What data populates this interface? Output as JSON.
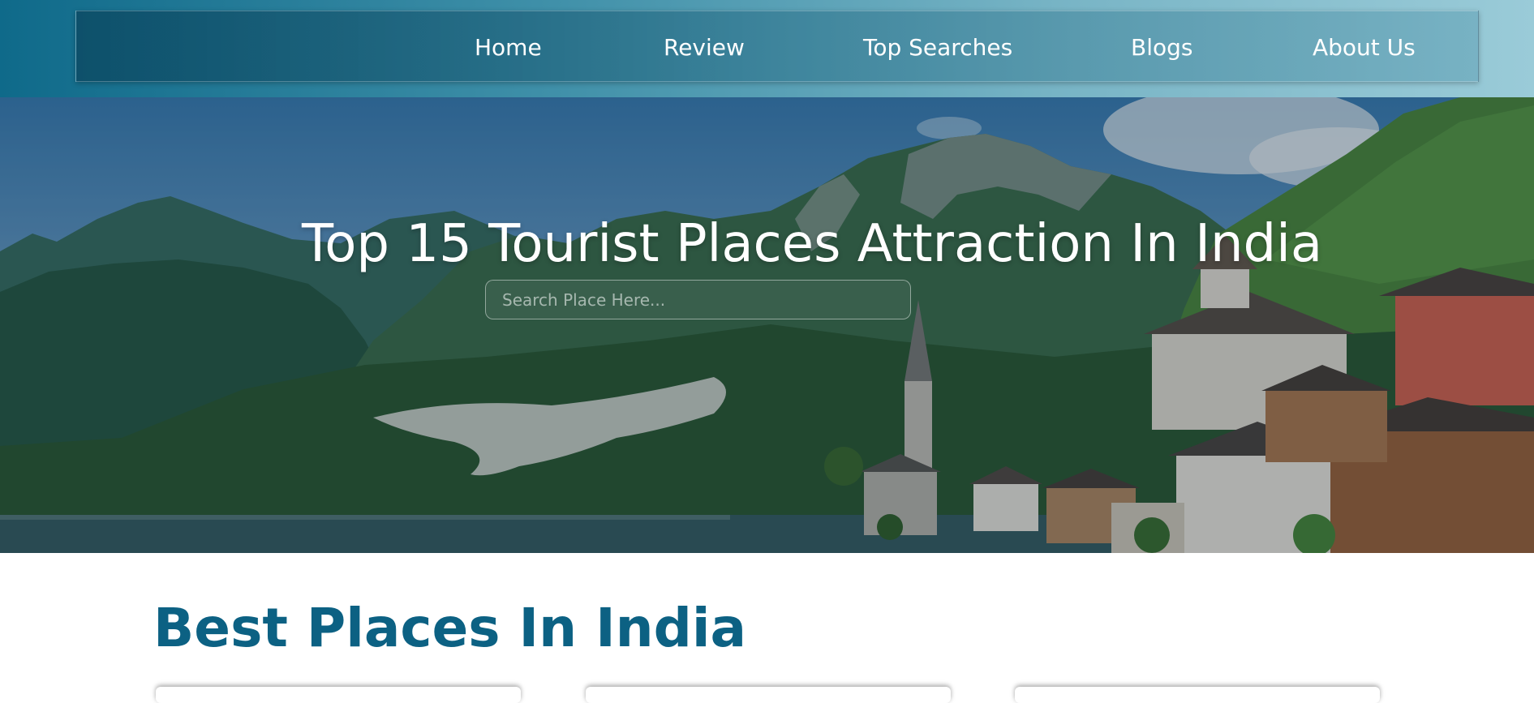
{
  "nav": {
    "items": [
      {
        "label": "Home"
      },
      {
        "label": "Review"
      },
      {
        "label": "Top Searches"
      },
      {
        "label": "Blogs"
      },
      {
        "label": "About Us"
      }
    ]
  },
  "hero": {
    "title": "Top 15 Tourist Places Attraction In India",
    "search": {
      "placeholder": "Search Place Here...",
      "value": ""
    }
  },
  "section": {
    "title": "Best Places In India"
  },
  "colors": {
    "accent": "#0c6183",
    "nav_gradient_start": "#0f6a8a",
    "nav_gradient_end": "#9acbd8"
  }
}
